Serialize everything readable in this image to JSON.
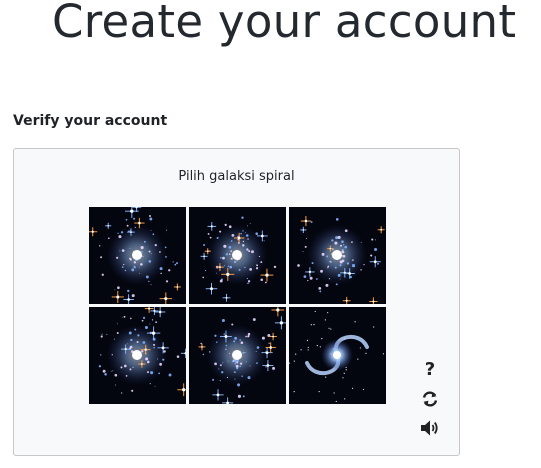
{
  "page": {
    "title": "Create your account"
  },
  "verify": {
    "label": "Verify your account",
    "captcha": {
      "prompt": "Pilih galaksi spiral",
      "tiles": [
        {
          "name": "captcha-tile-1",
          "kind": "star-cluster"
        },
        {
          "name": "captcha-tile-2",
          "kind": "star-cluster"
        },
        {
          "name": "captcha-tile-3",
          "kind": "star-cluster"
        },
        {
          "name": "captcha-tile-4",
          "kind": "star-cluster"
        },
        {
          "name": "captcha-tile-5",
          "kind": "star-cluster"
        },
        {
          "name": "captcha-tile-6",
          "kind": "spiral-galaxy"
        }
      ],
      "controls": {
        "help": "?",
        "refresh_icon": "refresh-icon",
        "audio_icon": "speaker-icon"
      }
    }
  },
  "colors": {
    "box_border": "#c7c7c7",
    "box_bg": "#f8f9fa",
    "text": "#1f2328",
    "space": "#04060f",
    "star_blue": "#7fb2ff",
    "star_orange": "#ff9a3c",
    "core": "#ffffff"
  }
}
